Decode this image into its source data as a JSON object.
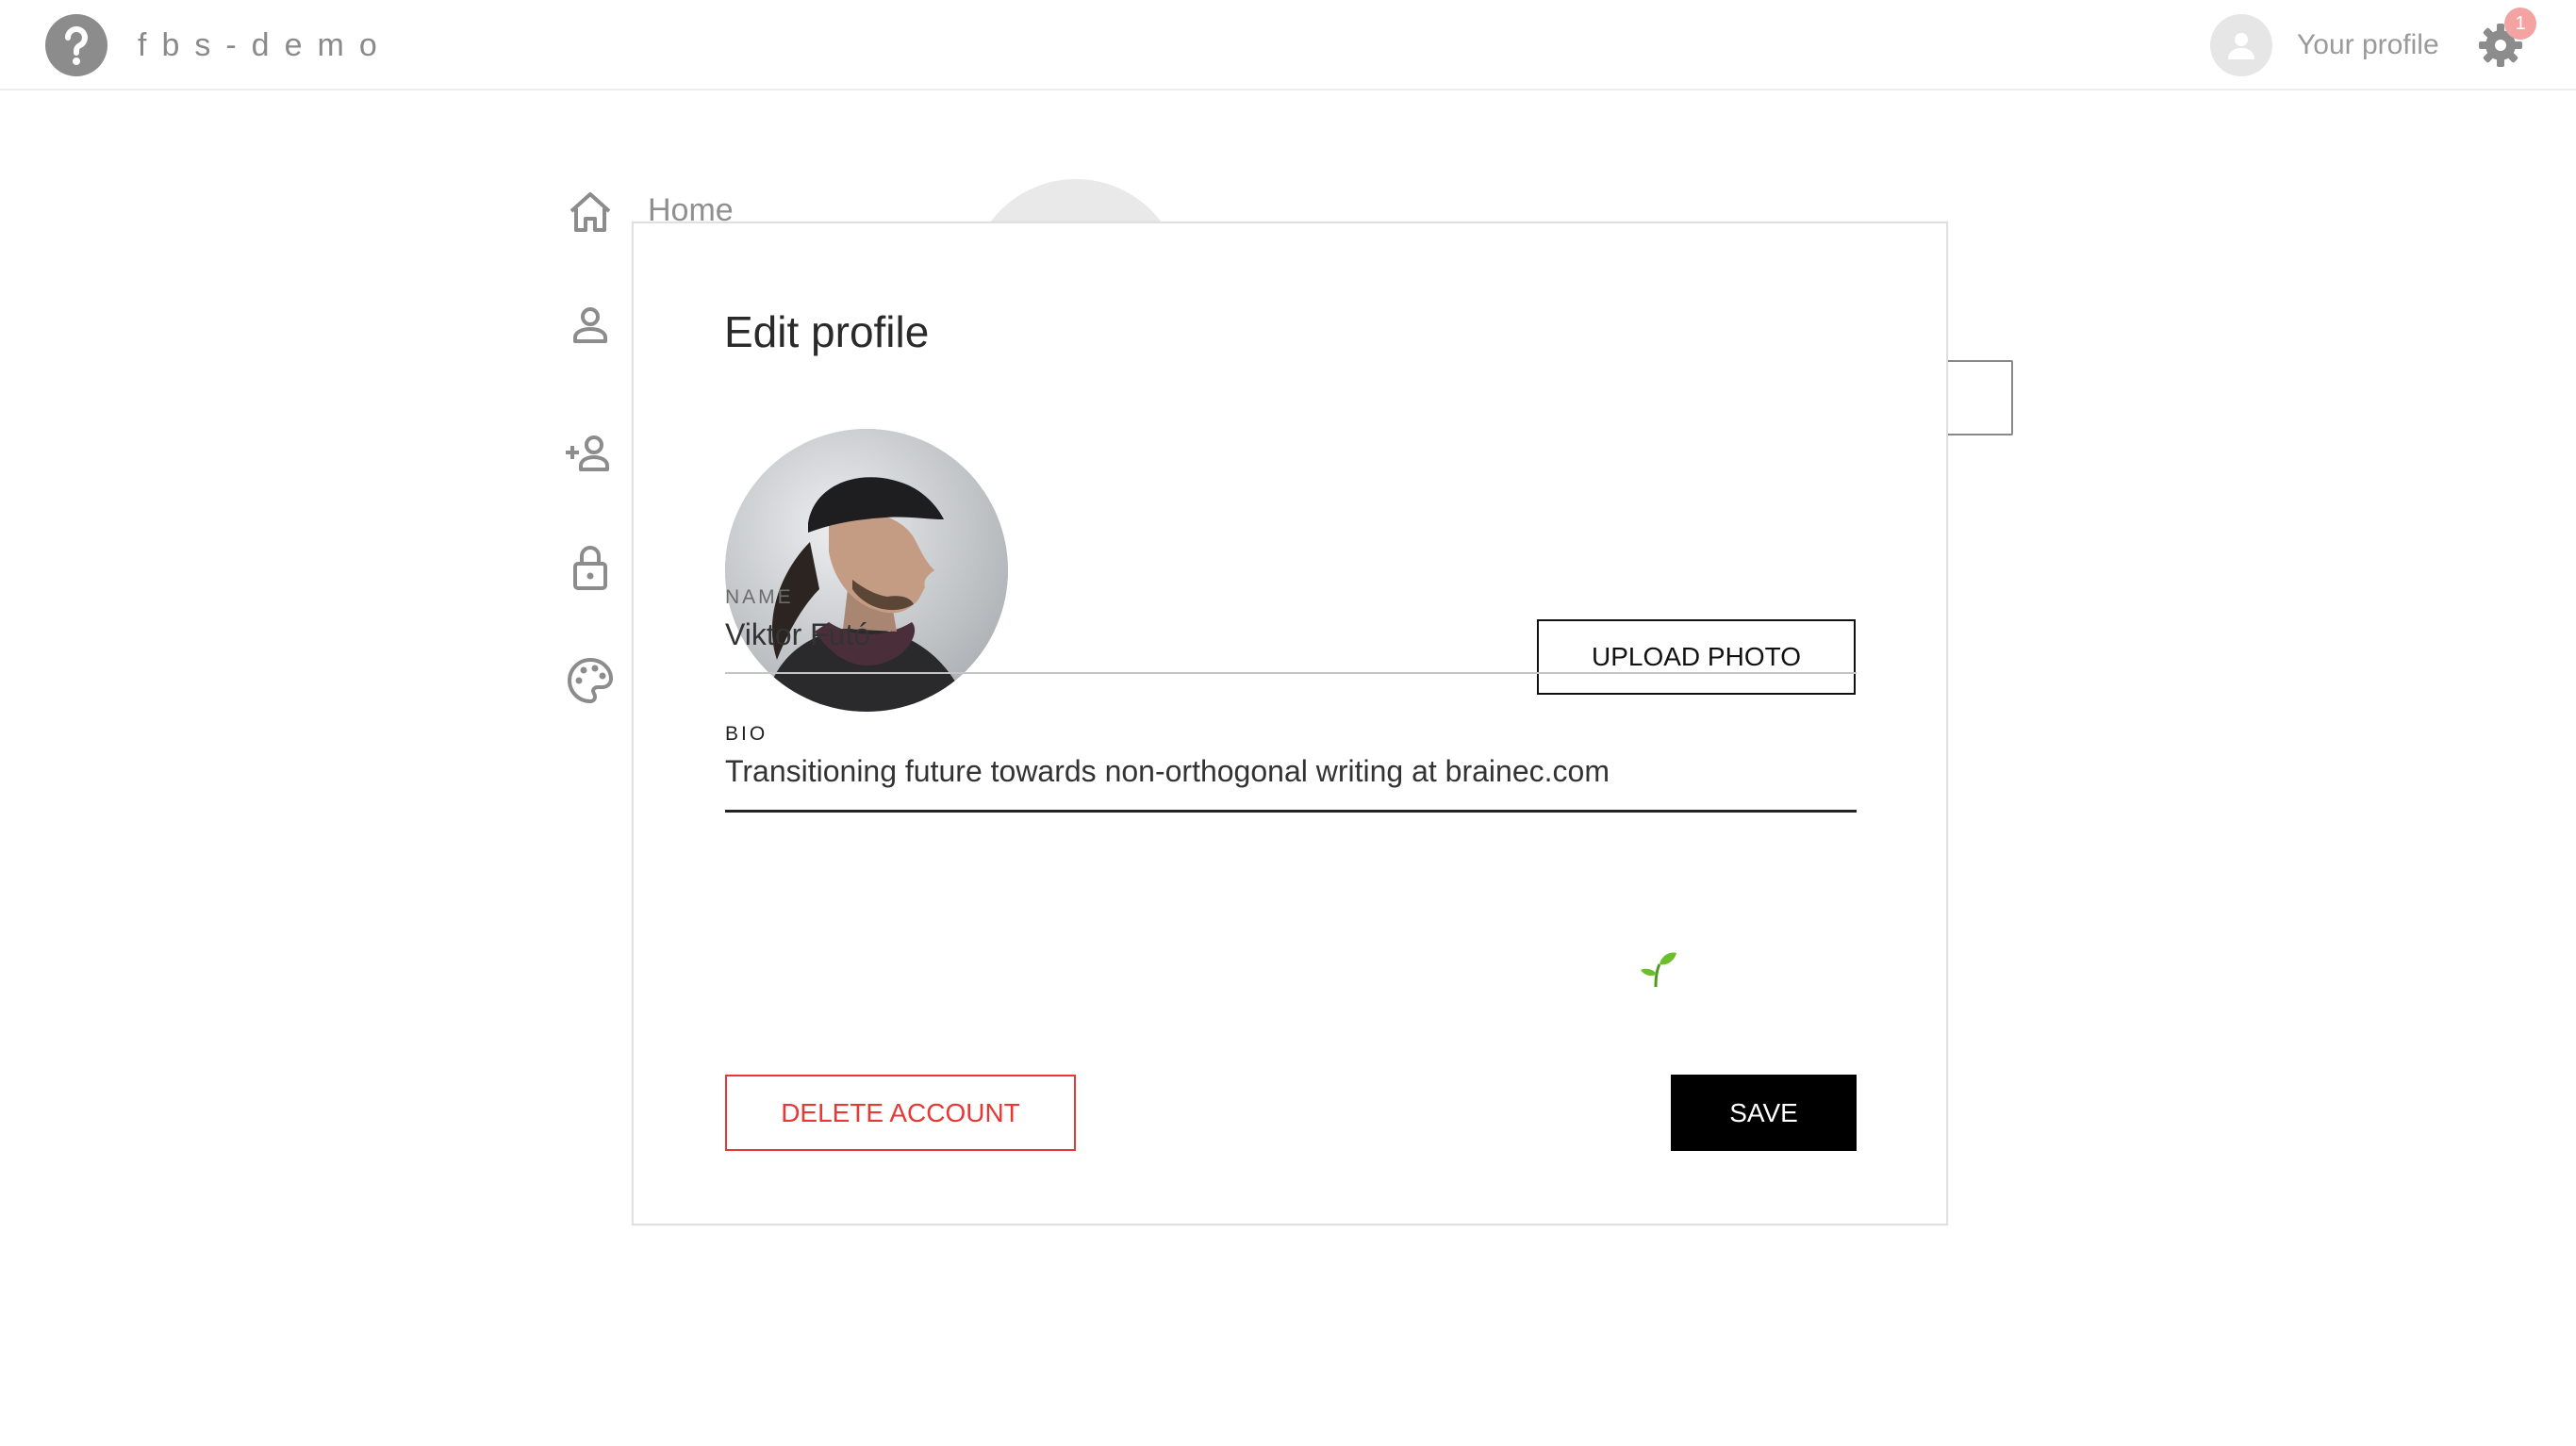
{
  "header": {
    "app_name": "fbs-demo",
    "profile_label": "Your profile",
    "notification_count": "1",
    "help_icon": "help-circle-icon",
    "settings_icon": "gear-icon"
  },
  "background": {
    "home_label": "Home",
    "sidebar_icons": [
      "home-icon",
      "person-icon",
      "add-person-icon",
      "lock-icon",
      "palette-icon"
    ]
  },
  "modal": {
    "title": "Edit profile",
    "upload_label": "UPLOAD PHOTO",
    "name_label": "NAME",
    "name_value": "Viktor Futó",
    "bio_label": "BIO",
    "bio_value": "Transitioning future towards non-orthogonal writing at brainec.com",
    "bio_emoji_icon": "seedling-icon",
    "delete_label": "DELETE ACCOUNT",
    "save_label": "SAVE"
  },
  "colors": {
    "danger": "#e53935",
    "primary": "#000000",
    "badge": "#f4a3a3",
    "muted": "#8a8a8a"
  }
}
